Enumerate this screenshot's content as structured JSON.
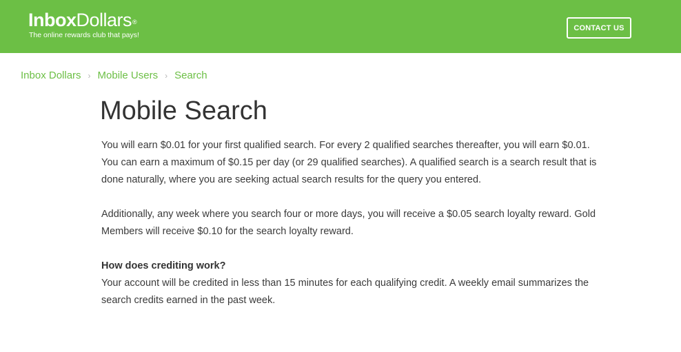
{
  "header": {
    "logo": {
      "bold": "Inbox",
      "regular": "Dollars",
      "trademark": "®",
      "tagline": "The online rewards club that pays!"
    },
    "contact_button": "CONTACT US",
    "background_color": "#6cbf45"
  },
  "breadcrumb": {
    "items": [
      "Inbox Dollars",
      "Mobile Users",
      "Search"
    ],
    "separator": "›"
  },
  "main": {
    "title": "Mobile Search",
    "paragraphs": [
      "You will earn $0.01 for your first qualified search. For every 2 qualified searches thereafter, you will earn $0.01. You can earn a maximum of $0.15 per day (or 29 qualified searches). A qualified search is a search result that is done naturally, where you are seeking actual search results for the query you entered.",
      "Additionally, any week where you search four or more days, you will receive a $0.05 search loyalty reward. Gold Members will receive $0.10 for the search loyalty reward."
    ],
    "faq": {
      "question": "How does crediting work?",
      "answer": "Your account will be credited in less than 15 minutes for each qualifying credit. A weekly email summarizes the search credits earned in the past week."
    }
  },
  "colors": {
    "brand_green": "#6cbf45",
    "text": "#3a3a3a"
  }
}
